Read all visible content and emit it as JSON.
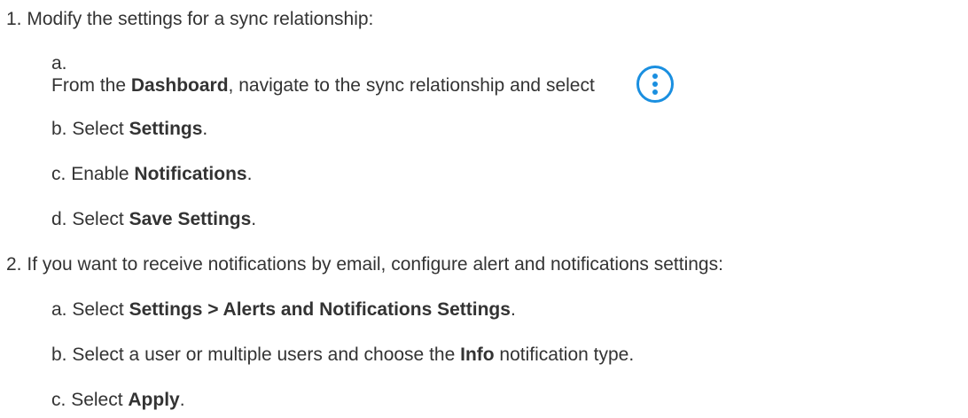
{
  "steps": [
    {
      "marker": "1.",
      "text": "Modify the settings for a sync relationship:",
      "substeps": [
        {
          "marker": "a.",
          "pre": "From the ",
          "bold": "Dashboard",
          "post": ", navigate to the sync relationship and select",
          "icon": "more-options-icon"
        },
        {
          "marker": "b.",
          "pre": "Select ",
          "bold": "Settings",
          "post": "."
        },
        {
          "marker": "c.",
          "pre": "Enable ",
          "bold": "Notifications",
          "post": "."
        },
        {
          "marker": "d.",
          "pre": "Select ",
          "bold": "Save Settings",
          "post": "."
        }
      ]
    },
    {
      "marker": "2.",
      "text": "If you want to receive notifications by email, configure alert and notifications settings:",
      "substeps": [
        {
          "marker": "a.",
          "pre": "Select ",
          "bold": "Settings > Alerts and Notifications Settings",
          "post": "."
        },
        {
          "marker": "b.",
          "pre": "Select a user or multiple users and choose the ",
          "bold": "Info",
          "post": " notification type."
        },
        {
          "marker": "c.",
          "pre": "Select ",
          "bold": "Apply",
          "post": "."
        }
      ]
    }
  ],
  "colors": {
    "text": "#333333",
    "icon_accent": "#1a8fe0"
  }
}
